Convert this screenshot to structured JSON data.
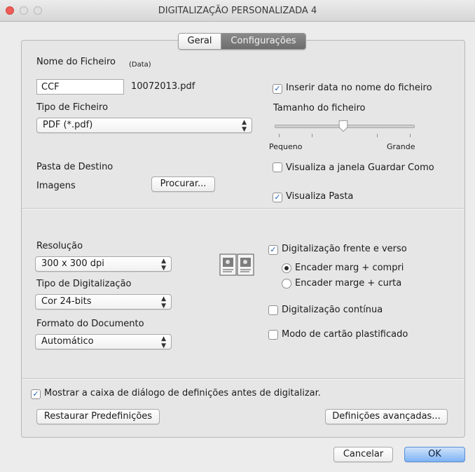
{
  "window": {
    "title": "DIGITALIZAÇÃO PERSONALIZADA 4"
  },
  "tabs": [
    {
      "label": "Geral",
      "selected": false
    },
    {
      "label": "Configurações",
      "selected": true
    }
  ],
  "file": {
    "name_label": "Nome do Ficheiro",
    "date_hint": "(Data)",
    "name_value": "CCF",
    "name_suffix": "10072013.pdf",
    "type_label": "Tipo de Ficheiro",
    "type_value": "PDF (*.pdf)",
    "insert_date_label": "Inserir data no nome do ficheiro",
    "insert_date_checked": true,
    "size_label": "Tamanho do ficheiro",
    "size_min_label": "Pequeno",
    "size_max_label": "Grande",
    "size_position": 0.4
  },
  "destination": {
    "label": "Pasta de Destino",
    "folder_value": "Imagens",
    "browse_button": "Procurar...",
    "show_save_as_label": "Visualiza a janela Guardar Como",
    "show_save_as_checked": false,
    "show_folder_label": "Visualiza Pasta",
    "show_folder_checked": true
  },
  "scan": {
    "resolution_label": "Resolução",
    "resolution_value": "300 x 300 dpi",
    "scan_type_label": "Tipo de Digitalização",
    "scan_type_value": "Cor 24-bits",
    "doc_size_label": "Formato do Documento",
    "doc_size_value": "Automático",
    "duplex_label": "Digitalização frente e verso",
    "duplex_checked": true,
    "long_edge_label": "Encader marg + compri",
    "long_edge_selected": true,
    "short_edge_label": "Encader marge + curta",
    "short_edge_selected": false,
    "continuous_label": "Digitalização contínua",
    "continuous_checked": false,
    "card_mode_label": "Modo de cartão plastificado",
    "card_mode_checked": false
  },
  "footer": {
    "show_dialog_label": "Mostrar a caixa de diálogo de definições antes de digitalizar.",
    "show_dialog_checked": true,
    "restore_button": "Restaurar Predefinições",
    "advanced_button": "Definições avançadas...",
    "cancel_button": "Cancelar",
    "ok_button": "OK"
  }
}
